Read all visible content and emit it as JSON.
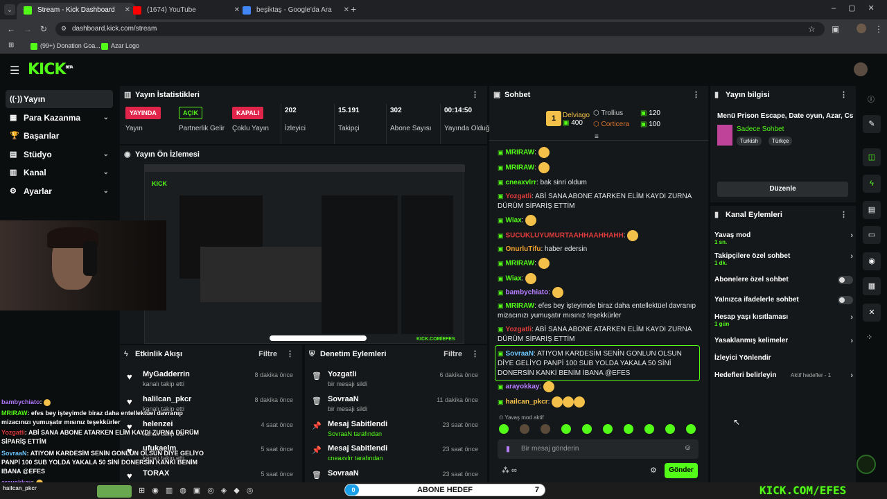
{
  "browser": {
    "tabs": [
      {
        "label": "Stream - Kick Dashboard",
        "color": "#53fc18"
      },
      {
        "label": "(1674) YouTube",
        "color": "#ff0000"
      },
      {
        "label": "beşiktaş - Google'da Ara",
        "color": "#4285f4"
      }
    ],
    "url": "dashboard.kick.com/stream",
    "bookmarks": [
      "(99+) Donation Goa...",
      "Azar Logo"
    ]
  },
  "header": {
    "logo": "KICK",
    "beta": "BETA"
  },
  "sidebar": {
    "items": [
      {
        "icon": "((·))",
        "label": "Yayın",
        "chev": ""
      },
      {
        "icon": "▦",
        "label": "Para Kazanma",
        "chev": "⌄"
      },
      {
        "icon": "🏆",
        "label": "Başarılar",
        "chev": ""
      },
      {
        "icon": "▤",
        "label": "Stüdyo",
        "chev": "⌄"
      },
      {
        "icon": "▥",
        "label": "Kanal",
        "chev": "⌄"
      },
      {
        "icon": "⚙",
        "label": "Ayarlar",
        "chev": "⌄"
      }
    ]
  },
  "stats": {
    "title": "Yayın İstatistikleri",
    "items": [
      {
        "badge": "YAYINDA",
        "label": "Yayın"
      },
      {
        "badge": "AÇIK",
        "label": "Partnerlik Gelir"
      },
      {
        "badge": "KAPALI",
        "label": "Çoklu Yayın"
      },
      {
        "value": "202",
        "label": "İzleyici"
      },
      {
        "value": "15.191",
        "label": "Takipçi"
      },
      {
        "value": "302",
        "label": "Abone Sayısı"
      },
      {
        "value": "00:14:50",
        "label": "Yayında Olduğu"
      }
    ]
  },
  "preview": {
    "title": "Yayın Ön İzlemesi"
  },
  "activity": {
    "title": "Etkinlik Akışı",
    "filter": "Filtre",
    "rows": [
      {
        "name": "MyGadderrin",
        "desc": "kanalı takip etti",
        "time": "8 dakika önce"
      },
      {
        "name": "halilcan_pkcr",
        "desc": "kanalı takip etti",
        "time": "8 dakika önce"
      },
      {
        "name": "helenzei",
        "desc": "kanalı takip etti",
        "time": "4 saat önce"
      },
      {
        "name": "ufukaelm",
        "desc": "kanalı takip etti",
        "time": "5 saat önce"
      },
      {
        "name": "TORAX",
        "desc": "",
        "time": "5 saat önce"
      }
    ]
  },
  "moderation": {
    "title": "Denetim Eylemleri",
    "filter": "Filtre",
    "rows": [
      {
        "icon": "🗑",
        "name": "Yozgatli",
        "desc": "bir mesajı sildi",
        "time": "6 dakika önce"
      },
      {
        "icon": "🗑",
        "name": "SovraaN",
        "desc": "bir mesajı sildi",
        "time": "11 dakika önce"
      },
      {
        "icon": "📌",
        "name": "Mesaj Sabitlendi",
        "desc": "SovraaN tarafından",
        "time": "23 saat önce"
      },
      {
        "icon": "📌",
        "name": "Mesaj Sabitlendi",
        "desc": "cneaxvlrr tarafından",
        "time": "23 saat önce"
      },
      {
        "icon": "🗑",
        "name": "SovraaN",
        "desc": "",
        "time": "23 saat önce"
      }
    ]
  },
  "chat": {
    "title": "Sohbet",
    "leaders": [
      {
        "name": "Delviago",
        "count": "400",
        "rank": "1"
      },
      {
        "name": "Trollius",
        "count": "120"
      },
      {
        "name": "Corticera",
        "count": "100"
      }
    ],
    "messages": [
      {
        "user": "MRIRAW",
        "color": "#53fc18",
        "text": ""
      },
      {
        "user": "MRIRAW",
        "color": "#53fc18",
        "text": ""
      },
      {
        "user": "cneaxvlrr",
        "color": "#53fc18",
        "text": "bak sinri oldum"
      },
      {
        "user": "Yozgatli",
        "color": "#e03c3c",
        "text": "ABİ SANA ABONE ATARKEN ELİM KAYDI ZURNA DÜRÜM SİPARİŞ ETTİM"
      },
      {
        "user": "Wiax",
        "color": "#53fc18",
        "text": ""
      },
      {
        "user": "SUCUKLUYUMURTAAHHAAHHAHH",
        "color": "#e03c3c",
        "text": ""
      },
      {
        "user": "OnurluTifu",
        "color": "#f0a030",
        "text": "haber edersin"
      },
      {
        "user": "MRIRAW",
        "color": "#53fc18",
        "text": ""
      },
      {
        "user": "Wiax",
        "color": "#53fc18",
        "text": ""
      },
      {
        "user": "bambychiato",
        "color": "#b47cff",
        "text": ""
      },
      {
        "user": "MRIRAW",
        "color": "#53fc18",
        "text": "efes bey işteyimde biraz daha entellektüel davranıp mizacınızı yumuşatır mısınız teşekkürler"
      },
      {
        "user": "Yozgatli",
        "color": "#e03c3c",
        "text": "ABİ SANA ABONE ATARKEN ELİM KAYDI ZURNA DÜRÜM SİPARİŞ ETTİM"
      },
      {
        "user": "SovraaN",
        "color": "#6ec6ff",
        "text": "ATIYOM KARDESİM SENİN GONLUN OLSUN DİYE GELİYO PANPİ 100 SUB YOLDA YAKALA 50 SİNİ DONERSİN KANKİ BENİM İBANA @EFES"
      },
      {
        "user": "arayokkay",
        "color": "#b47cff",
        "text": ""
      },
      {
        "user": "hailcan_pkcr",
        "color": "#f3c04a",
        "text": ""
      }
    ],
    "slow_mode": "Yavaş mod aktif",
    "input_placeholder": "Bir mesaj gönderin",
    "send": "Gönder"
  },
  "info": {
    "title": "Yayın bilgisi",
    "stream_title": "Menü Prison Escape, Date oyun, Azar, Cs",
    "category": "Sadece Sohbet",
    "tags": [
      "Turkish",
      "Türkçe"
    ],
    "edit": "Düzenle"
  },
  "actions": {
    "title": "Kanal Eylemleri",
    "rows": [
      {
        "label": "Yavaş mod",
        "sub": "1 sn.",
        "type": "arrow"
      },
      {
        "label": "Takipçilere özel sohbet",
        "sub": "1 dk.",
        "type": "arrow"
      },
      {
        "label": "Abonelere özel sohbet",
        "sub": "",
        "type": "toggle"
      },
      {
        "label": "Yalnızca ifadelerle sohbet",
        "sub": "",
        "type": "toggle"
      },
      {
        "label": "Hesap yaşı kısıtlaması",
        "sub": "1 gün",
        "type": "arrow"
      },
      {
        "label": "Yasaklanmış kelimeler",
        "sub": "",
        "type": "arrow"
      },
      {
        "label": "İzleyici Yönlendir",
        "sub": "",
        "type": "none"
      },
      {
        "label": "Hedefleri belirleyin",
        "sub": "",
        "type": "goal",
        "extra": "Aktif hedefler - 1"
      }
    ]
  },
  "overlay": {
    "chat": [
      {
        "user": "bambychiato",
        "color": "#b47cff",
        "text": ""
      },
      {
        "user": "MRIRAW",
        "color": "#53fc18",
        "text": "efes bey işteyimde biraz daha entellektüel davranıp mizacınızı yumuşatır mısınız teşekkürler"
      },
      {
        "user": "Yozgatli",
        "color": "#e03c3c",
        "text": "ABİ SANA ABONE ATARKEN ELİM KAYDI ZURNA DÜRÜM SİPARİŞ ETTİM"
      },
      {
        "user": "SovraaN",
        "color": "#6ec6ff",
        "text": "ATIYOM KARDESİM SENİN GONLUN OLSUN DİYE GELİYO PANPİ 100 SUB YOLDA YAKALA 50 SİNİ DONERSIN KANKİ BENİM IBANA @EFES"
      },
      {
        "user": "arayokkay",
        "color": "#b47cff",
        "text": ""
      }
    ],
    "goal_label": "ABONE HEDEF",
    "goal_start": "0",
    "goal_end": "7",
    "goal_progress": 0.02,
    "watermark": "KICK.COM/EFES"
  }
}
